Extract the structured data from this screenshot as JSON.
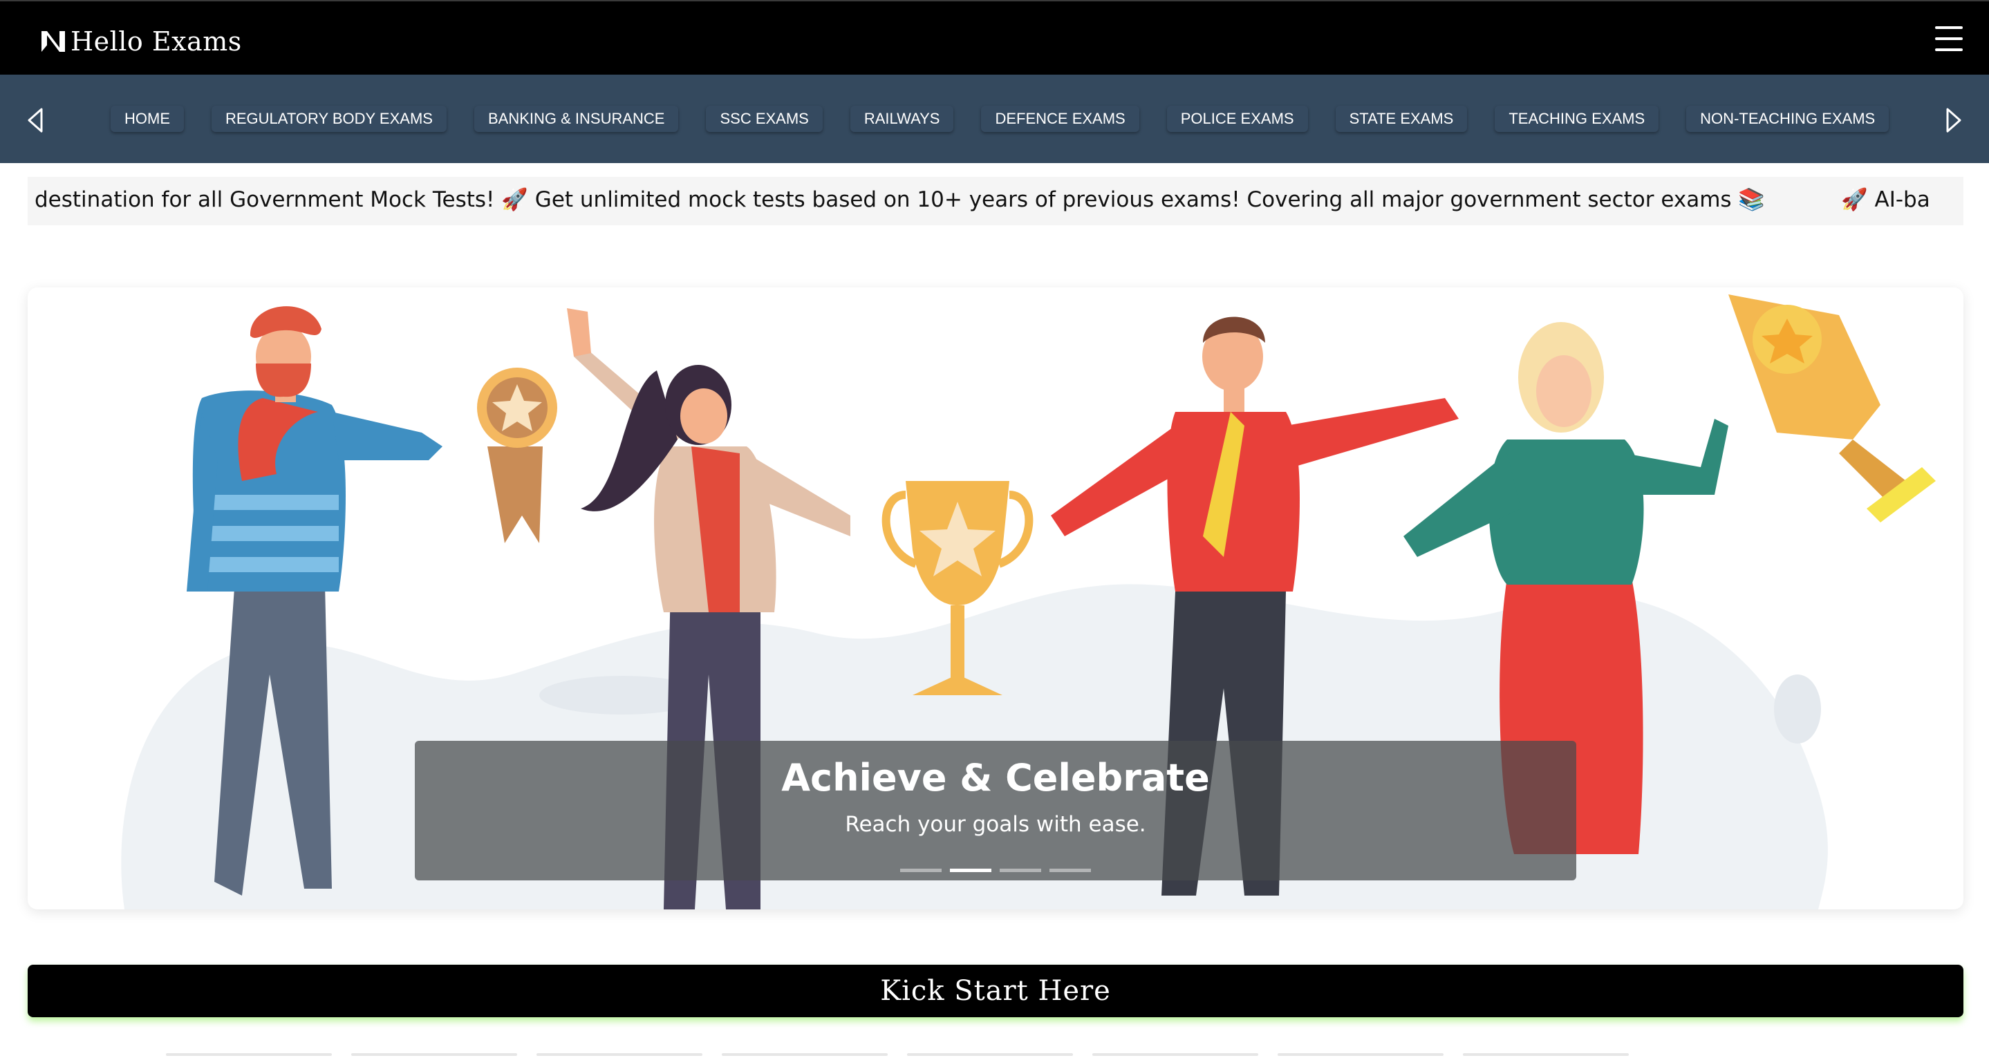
{
  "header": {
    "brand": "Hello Exams",
    "logo_icon": "n-logo-icon",
    "menu_icon": "hamburger-icon"
  },
  "nav": {
    "prev_icon": "chevron-left-icon",
    "next_icon": "chevron-right-icon",
    "items": [
      {
        "label": "HOME"
      },
      {
        "label": "REGULATORY BODY EXAMS"
      },
      {
        "label": "BANKING & INSURANCE"
      },
      {
        "label": "SSC EXAMS"
      },
      {
        "label": "RAILWAYS"
      },
      {
        "label": "DEFENCE EXAMS"
      },
      {
        "label": "POLICE EXAMS"
      },
      {
        "label": "STATE EXAMS"
      },
      {
        "label": "TEACHING EXAMS"
      },
      {
        "label": "NON-TEACHING EXAMS"
      }
    ]
  },
  "marquee": {
    "part1": "destination for all Government Mock Tests! ",
    "rocket": "🚀",
    "part2": " Get unlimited mock tests based on 10+ years of previous exams! Covering all major government sector exams ",
    "books": "📚",
    "part3": "AI-ba"
  },
  "hero": {
    "title": "Achieve & Celebrate",
    "subtitle": "Reach your goals with ease.",
    "slides_count": 4,
    "active_slide": 2
  },
  "cta": {
    "label": "Kick Start Here"
  },
  "colors": {
    "header_bg": "#000000",
    "nav_bg": "#34495e",
    "cta_glow": "#aaf082"
  }
}
